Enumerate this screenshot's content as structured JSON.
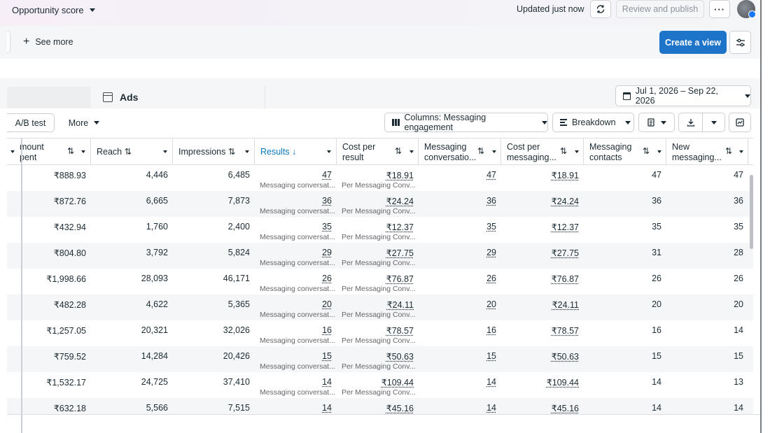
{
  "topbar": {
    "opportunity": "Opportunity score",
    "updated": "Updated just now",
    "review_publish": "Review and publish",
    "more": "···"
  },
  "actions": {
    "see_more": "See more",
    "create_view": "Create a view"
  },
  "tabs": {
    "ads": "Ads"
  },
  "date_range": "Jul 1, 2026 – Sep 22, 2026",
  "toolbar": {
    "ab_test": "A/B test",
    "more": "More",
    "columns": "Columns: Messaging engagement",
    "breakdown": "Breakdown"
  },
  "table": {
    "headers": [
      {
        "line1": "mount",
        "line2": "pent"
      },
      {
        "line1": "Reach",
        "line2": ""
      },
      {
        "line1": "Impressions",
        "line2": ""
      },
      {
        "line1": "Results",
        "line2": ""
      },
      {
        "line1": "Cost per",
        "line2": "result"
      },
      {
        "line1": "Messaging",
        "line2": "conversatio..."
      },
      {
        "line1": "Cost per",
        "line2": "messaging..."
      },
      {
        "line1": "Messaging",
        "line2": "contacts"
      },
      {
        "line1": "New",
        "line2": "messaging..."
      }
    ],
    "results_sublabel": "Messaging conversat...",
    "cost_sublabel": "Per Messaging Conv...",
    "rows": [
      {
        "amount": "₹888.93",
        "reach": "4,446",
        "impressions": "6,485",
        "results": "47",
        "cost": "₹18.91",
        "conv": "47",
        "cost_msg": "₹18.91",
        "contacts": "47",
        "new": "47"
      },
      {
        "amount": "₹872.76",
        "reach": "6,665",
        "impressions": "7,873",
        "results": "36",
        "cost": "₹24.24",
        "conv": "36",
        "cost_msg": "₹24.24",
        "contacts": "36",
        "new": "36"
      },
      {
        "amount": "₹432.94",
        "reach": "1,760",
        "impressions": "2,400",
        "results": "35",
        "cost": "₹12.37",
        "conv": "35",
        "cost_msg": "₹12.37",
        "contacts": "35",
        "new": "35"
      },
      {
        "amount": "₹804.80",
        "reach": "3,792",
        "impressions": "5,824",
        "results": "29",
        "cost": "₹27.75",
        "conv": "29",
        "cost_msg": "₹27.75",
        "contacts": "31",
        "new": "28"
      },
      {
        "amount": "₹1,998.66",
        "reach": "28,093",
        "impressions": "46,171",
        "results": "26",
        "cost": "₹76.87",
        "conv": "26",
        "cost_msg": "₹76.87",
        "contacts": "26",
        "new": "26"
      },
      {
        "amount": "₹482.28",
        "reach": "4,622",
        "impressions": "5,365",
        "results": "20",
        "cost": "₹24.11",
        "conv": "20",
        "cost_msg": "₹24.11",
        "contacts": "20",
        "new": "20"
      },
      {
        "amount": "₹1,257.05",
        "reach": "20,321",
        "impressions": "32,026",
        "results": "16",
        "cost": "₹78.57",
        "conv": "16",
        "cost_msg": "₹78.57",
        "contacts": "16",
        "new": "14"
      },
      {
        "amount": "₹759.52",
        "reach": "14,284",
        "impressions": "20,426",
        "results": "15",
        "cost": "₹50.63",
        "conv": "15",
        "cost_msg": "₹50.63",
        "contacts": "15",
        "new": "15"
      },
      {
        "amount": "₹1,532.17",
        "reach": "24,725",
        "impressions": "37,410",
        "results": "14",
        "cost": "₹109.44",
        "conv": "14",
        "cost_msg": "₹109.44",
        "contacts": "14",
        "new": "13"
      },
      {
        "amount": "₹632.18",
        "reach": "5,566",
        "impressions": "7,515",
        "results": "14",
        "cost": "₹45.16",
        "conv": "14",
        "cost_msg": "₹45.16",
        "contacts": "14",
        "new": "14"
      }
    ]
  },
  "colors": {
    "primary_button": "#1d74c8",
    "active_sort": "#0a78be"
  }
}
